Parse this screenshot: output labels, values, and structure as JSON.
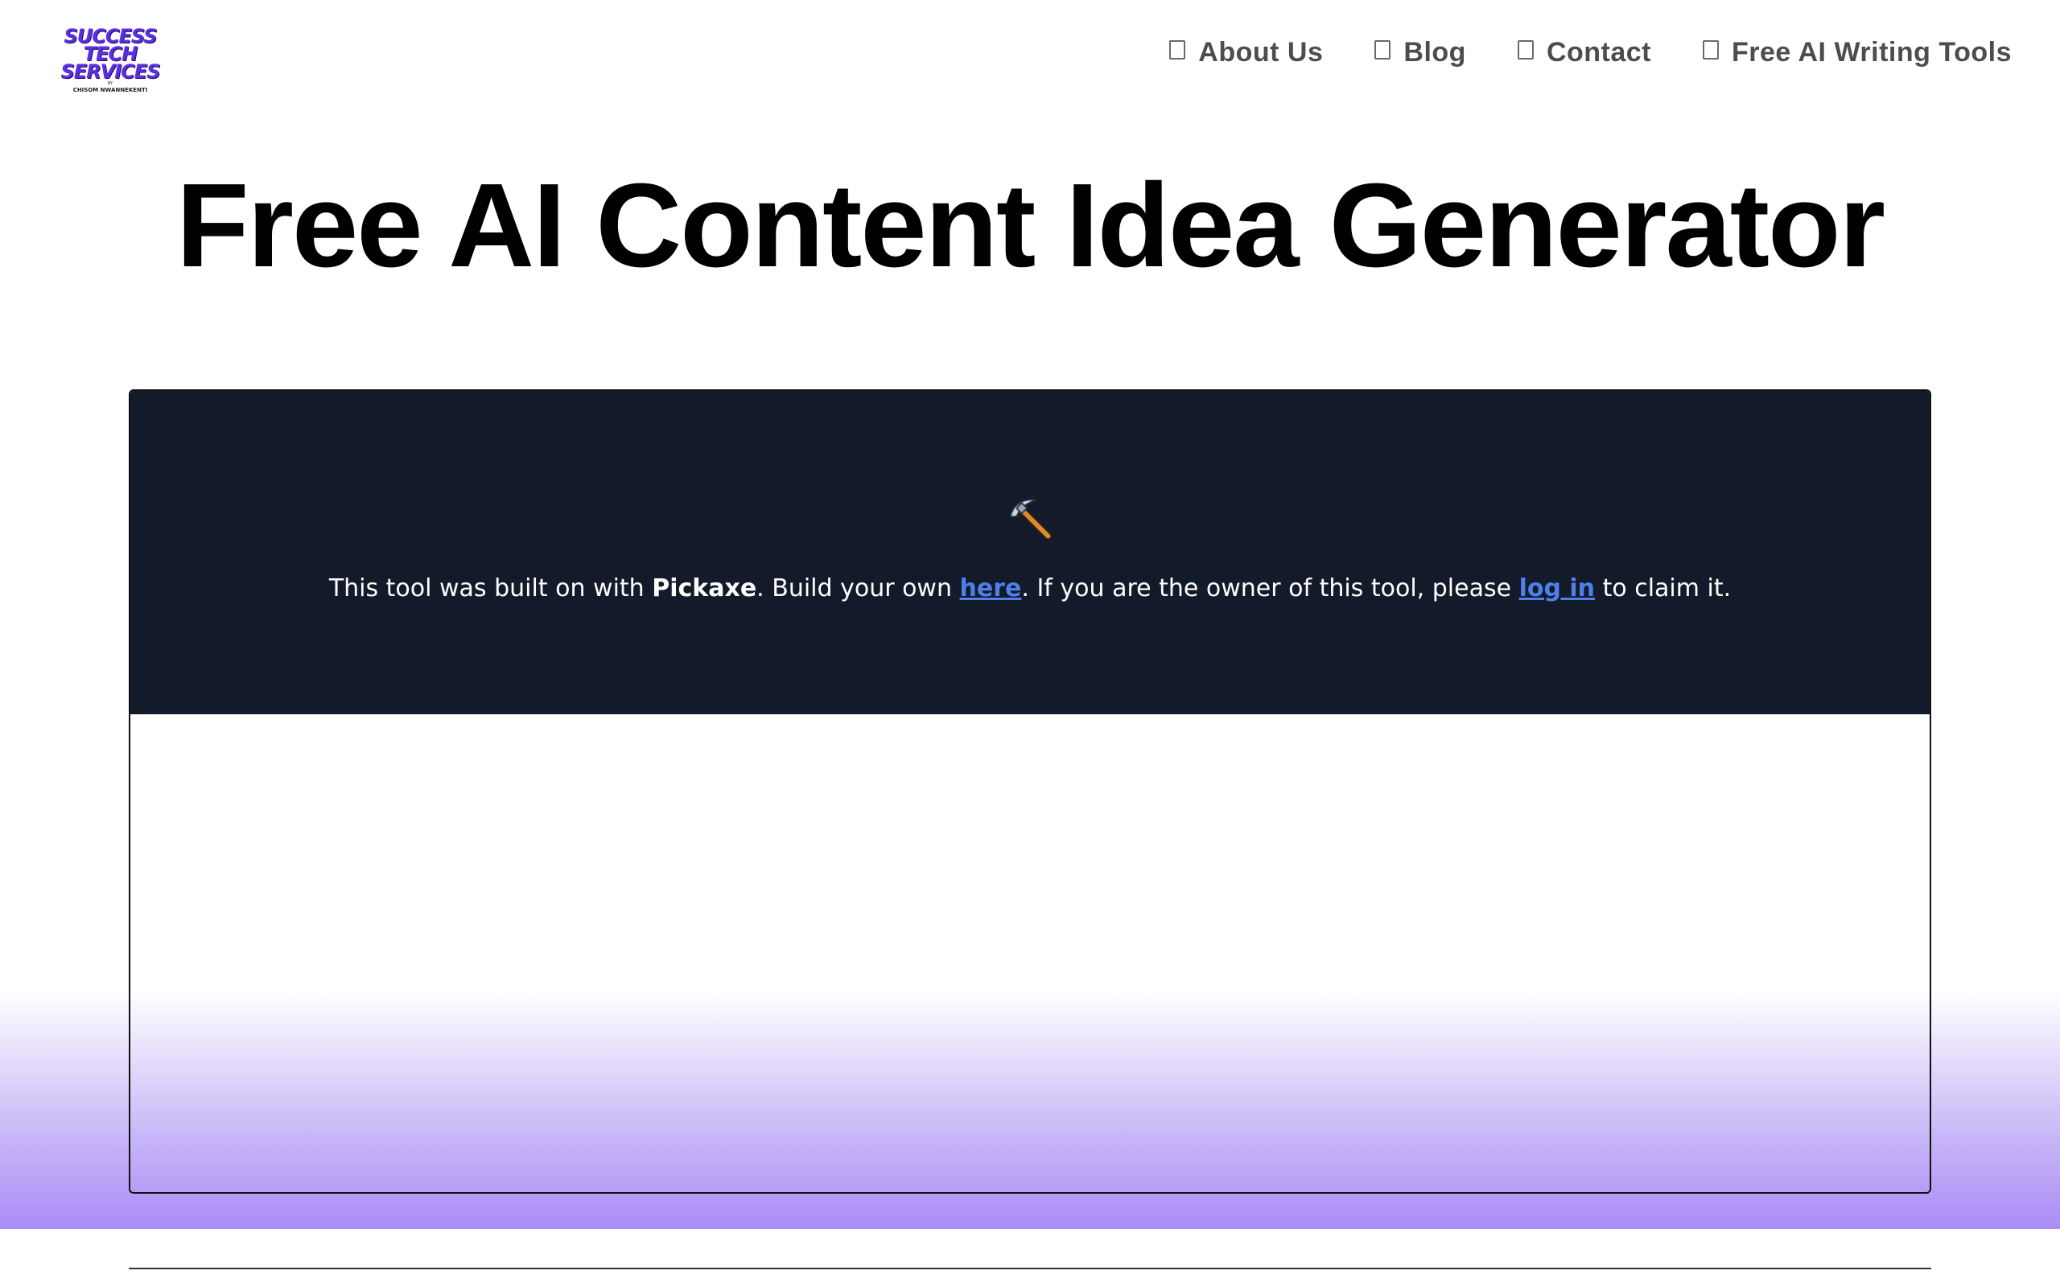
{
  "logo": {
    "line1": "SUCCESS",
    "line2": "TECH",
    "line3": "SERVICES",
    "by": "BY",
    "name": "CHISOM NWANNEKENTI",
    "accent_color": "#5b2ee6"
  },
  "nav": {
    "items": [
      {
        "label": "About Us",
        "icon": "checkbox-icon"
      },
      {
        "label": "Blog",
        "icon": "checkbox-icon"
      },
      {
        "label": "Contact",
        "icon": "checkbox-icon"
      },
      {
        "label": "Free AI Writing Tools",
        "icon": "checkbox-icon"
      }
    ]
  },
  "page": {
    "title": "Free AI Content Idea Generator"
  },
  "embed": {
    "icon": "pickaxe-icon",
    "notice": {
      "part1": "This tool was built on with ",
      "brand": "Pickaxe",
      "part2": ". Build your own ",
      "link_here": "here",
      "part3": ". If you are the owner of this tool, please ",
      "link_login": "log in",
      "part4": " to claim it."
    },
    "background_color": "#131a29",
    "link_color": "#4f7fe8"
  },
  "theme": {
    "gradient_color": "#ab8cf5"
  }
}
